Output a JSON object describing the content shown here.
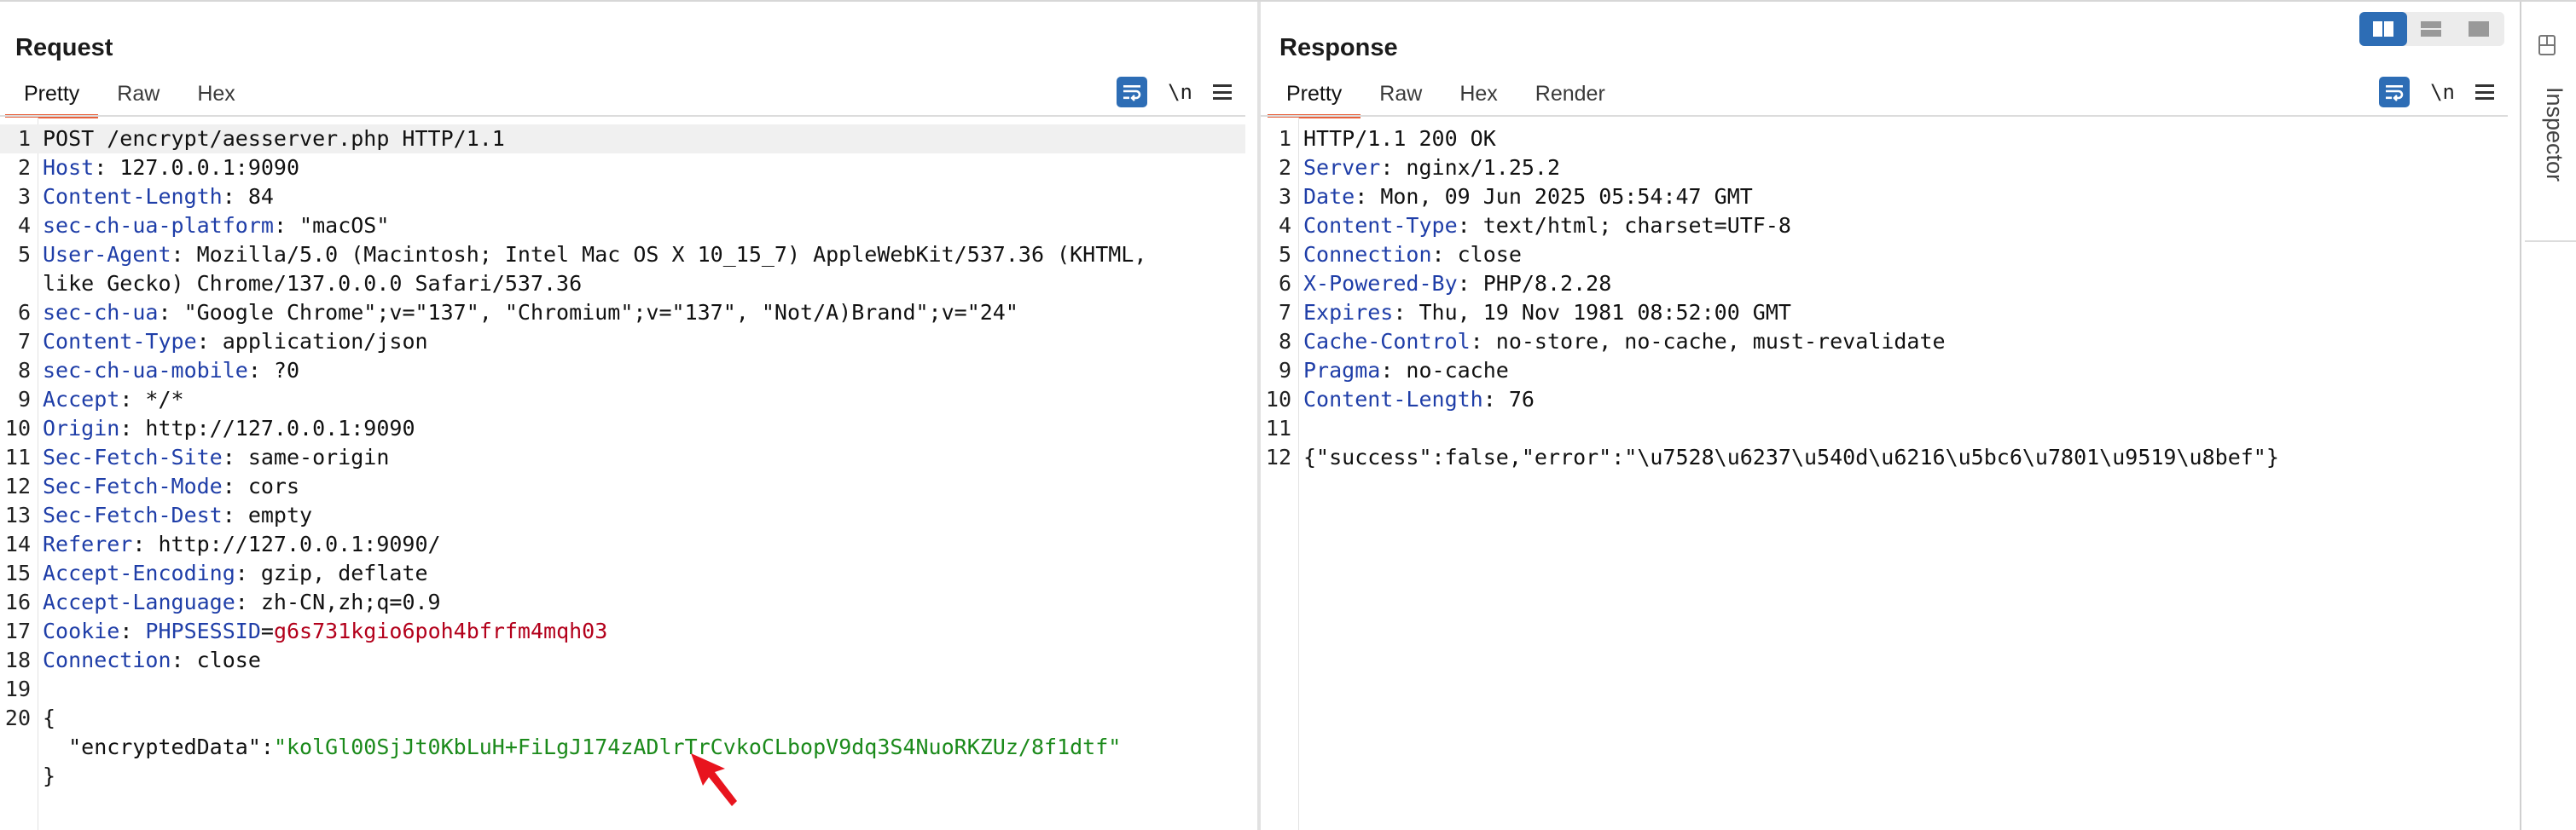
{
  "request": {
    "title": "Request",
    "tabs": [
      "Pretty",
      "Raw",
      "Hex"
    ],
    "active_tab": "Pretty",
    "tools": {
      "newline_toggle": "\\n",
      "wrap_icon": "text-wrap-icon",
      "menu_icon": "hamburger-menu-icon"
    },
    "lines": [
      {
        "n": "1",
        "parts": [
          {
            "t": "POST /encrypt/aesserver.php HTTP/1.1",
            "c": ""
          }
        ]
      },
      {
        "n": "2",
        "parts": [
          {
            "t": "Host",
            "c": "hk"
          },
          {
            "t": ": 127.0.0.1:9090",
            "c": ""
          }
        ]
      },
      {
        "n": "3",
        "parts": [
          {
            "t": "Content-Length",
            "c": "hk"
          },
          {
            "t": ": 84",
            "c": ""
          }
        ]
      },
      {
        "n": "4",
        "parts": [
          {
            "t": "sec-ch-ua-platform",
            "c": "hk"
          },
          {
            "t": ": \"macOS\"",
            "c": ""
          }
        ]
      },
      {
        "n": "5",
        "parts": [
          {
            "t": "User-Agent",
            "c": "hk"
          },
          {
            "t": ": Mozilla/5.0 (Macintosh; Intel Mac OS X 10_15_7) AppleWebKit/537.36 (KHTML,",
            "c": ""
          }
        ]
      },
      {
        "n": "",
        "parts": [
          {
            "t": "like Gecko) Chrome/137.0.0.0 Safari/537.36",
            "c": ""
          }
        ]
      },
      {
        "n": "6",
        "parts": [
          {
            "t": "sec-ch-ua",
            "c": "hk"
          },
          {
            "t": ": \"Google Chrome\";v=\"137\", \"Chromium\";v=\"137\", \"Not/A)Brand\";v=\"24\"",
            "c": ""
          }
        ]
      },
      {
        "n": "7",
        "parts": [
          {
            "t": "Content-Type",
            "c": "hk"
          },
          {
            "t": ": application/json",
            "c": ""
          }
        ]
      },
      {
        "n": "8",
        "parts": [
          {
            "t": "sec-ch-ua-mobile",
            "c": "hk"
          },
          {
            "t": ": ?0",
            "c": ""
          }
        ]
      },
      {
        "n": "9",
        "parts": [
          {
            "t": "Accept",
            "c": "hk"
          },
          {
            "t": ": */*",
            "c": ""
          }
        ]
      },
      {
        "n": "10",
        "parts": [
          {
            "t": "Origin",
            "c": "hk"
          },
          {
            "t": ": http://127.0.0.1:9090",
            "c": ""
          }
        ]
      },
      {
        "n": "11",
        "parts": [
          {
            "t": "Sec-Fetch-Site",
            "c": "hk"
          },
          {
            "t": ": same-origin",
            "c": ""
          }
        ]
      },
      {
        "n": "12",
        "parts": [
          {
            "t": "Sec-Fetch-Mode",
            "c": "hk"
          },
          {
            "t": ": cors",
            "c": ""
          }
        ]
      },
      {
        "n": "13",
        "parts": [
          {
            "t": "Sec-Fetch-Dest",
            "c": "hk"
          },
          {
            "t": ": empty",
            "c": ""
          }
        ]
      },
      {
        "n": "14",
        "parts": [
          {
            "t": "Referer",
            "c": "hk"
          },
          {
            "t": ": http://127.0.0.1:9090/",
            "c": ""
          }
        ]
      },
      {
        "n": "15",
        "parts": [
          {
            "t": "Accept-Encoding",
            "c": "hk"
          },
          {
            "t": ": gzip, deflate",
            "c": ""
          }
        ]
      },
      {
        "n": "16",
        "parts": [
          {
            "t": "Accept-Language",
            "c": "hk"
          },
          {
            "t": ": zh-CN,zh;q=0.9",
            "c": ""
          }
        ]
      },
      {
        "n": "17",
        "parts": [
          {
            "t": "Cookie",
            "c": "hk"
          },
          {
            "t": ": ",
            "c": ""
          },
          {
            "t": "PHPSESSID",
            "c": "ck"
          },
          {
            "t": "=",
            "c": ""
          },
          {
            "t": "g6s731kgio6poh4bfrfm4mqh03",
            "c": "cv"
          }
        ]
      },
      {
        "n": "18",
        "parts": [
          {
            "t": "Connection",
            "c": "hk"
          },
          {
            "t": ": close",
            "c": ""
          }
        ]
      },
      {
        "n": "19",
        "parts": [
          {
            "t": "",
            "c": ""
          }
        ]
      },
      {
        "n": "20",
        "parts": [
          {
            "t": "{",
            "c": ""
          }
        ]
      },
      {
        "n": "",
        "parts": [
          {
            "t": "  \"encryptedData\":",
            "c": ""
          },
          {
            "t": "\"kolGl00SjJt0KbLuH+FiLgJ174zADlrTrCvkoCLbopV9dq3S4NuoRKZUz/8f1dtf\"",
            "c": "js"
          }
        ]
      },
      {
        "n": "",
        "parts": [
          {
            "t": "}",
            "c": ""
          }
        ]
      }
    ]
  },
  "response": {
    "title": "Response",
    "tabs": [
      "Pretty",
      "Raw",
      "Hex",
      "Render"
    ],
    "active_tab": "Pretty",
    "tools": {
      "newline_toggle": "\\n",
      "wrap_icon": "text-wrap-icon",
      "menu_icon": "hamburger-menu-icon"
    },
    "lines": [
      {
        "n": "1",
        "parts": [
          {
            "t": "HTTP/1.1 200 OK",
            "c": ""
          }
        ]
      },
      {
        "n": "2",
        "parts": [
          {
            "t": "Server",
            "c": "hk"
          },
          {
            "t": ": nginx/1.25.2",
            "c": ""
          }
        ]
      },
      {
        "n": "3",
        "parts": [
          {
            "t": "Date",
            "c": "hk"
          },
          {
            "t": ": Mon, 09 Jun 2025 05:54:47 GMT",
            "c": ""
          }
        ]
      },
      {
        "n": "4",
        "parts": [
          {
            "t": "Content-Type",
            "c": "hk"
          },
          {
            "t": ": text/html; charset=UTF-8",
            "c": ""
          }
        ]
      },
      {
        "n": "5",
        "parts": [
          {
            "t": "Connection",
            "c": "hk"
          },
          {
            "t": ": close",
            "c": ""
          }
        ]
      },
      {
        "n": "6",
        "parts": [
          {
            "t": "X-Powered-By",
            "c": "hk"
          },
          {
            "t": ": PHP/8.2.28",
            "c": ""
          }
        ]
      },
      {
        "n": "7",
        "parts": [
          {
            "t": "Expires",
            "c": "hk"
          },
          {
            "t": ": Thu, 19 Nov 1981 08:52:00 GMT",
            "c": ""
          }
        ]
      },
      {
        "n": "8",
        "parts": [
          {
            "t": "Cache-Control",
            "c": "hk"
          },
          {
            "t": ": no-store, no-cache, must-revalidate",
            "c": ""
          }
        ]
      },
      {
        "n": "9",
        "parts": [
          {
            "t": "Pragma",
            "c": "hk"
          },
          {
            "t": ": no-cache",
            "c": ""
          }
        ]
      },
      {
        "n": "10",
        "parts": [
          {
            "t": "Content-Length",
            "c": "hk"
          },
          {
            "t": ": 76",
            "c": ""
          }
        ]
      },
      {
        "n": "11",
        "parts": [
          {
            "t": "",
            "c": ""
          }
        ]
      },
      {
        "n": "12",
        "parts": [
          {
            "t": "{\"success\":false,\"error\":\"\\u7528\\u6237\\u540d\\u6216\\u5bc6\\u7801\\u9519\\u8bef\"}",
            "c": ""
          }
        ]
      }
    ]
  },
  "inspector": {
    "label": "Inspector",
    "icon": "inspector-layout-icon"
  },
  "layout_toggle": {
    "options": [
      "split-columns-icon",
      "split-rows-icon",
      "single-pane-icon"
    ],
    "active": "split-columns-icon"
  },
  "annotation": {
    "icon": "red-arrow-pointer-icon",
    "color": "#e8141e"
  },
  "colors": {
    "accent": "#2d6db5",
    "tab_underline": "#e8613c",
    "header_key": "#1f3ea8",
    "cookie_value": "#b3001b",
    "json_string": "#1b8a1b"
  }
}
